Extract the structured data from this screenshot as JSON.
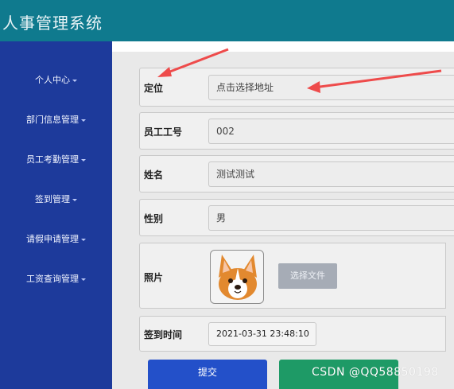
{
  "header": {
    "title": "人事管理系统"
  },
  "sidebar": {
    "items": [
      {
        "label": "个人中心"
      },
      {
        "label": "部门信息管理"
      },
      {
        "label": "员工考勤管理"
      },
      {
        "label": "签到管理"
      },
      {
        "label": "请假申请管理"
      },
      {
        "label": "工资查询管理"
      }
    ]
  },
  "form": {
    "location": {
      "label": "定位",
      "value": "点击选择地址"
    },
    "employee_id": {
      "label": "员工工号",
      "value": "002"
    },
    "name": {
      "label": "姓名",
      "value": "测试测试"
    },
    "gender": {
      "label": "性别",
      "value": "男"
    },
    "photo": {
      "label": "照片",
      "button": "选择文件",
      "icon": "corgi-avatar"
    },
    "checkin_time": {
      "label": "签到时间",
      "value": "2021-03-31 23:48:10"
    }
  },
  "actions": {
    "submit": "提交",
    "reset": ""
  },
  "watermark": "CSDN @QQ58850198",
  "colors": {
    "header": "#0f7a8e",
    "sidebar": "#1d3a9b",
    "submit": "#2350c9",
    "reset": "#1e9a66",
    "annotation_arrow": "#ee4b4b"
  }
}
